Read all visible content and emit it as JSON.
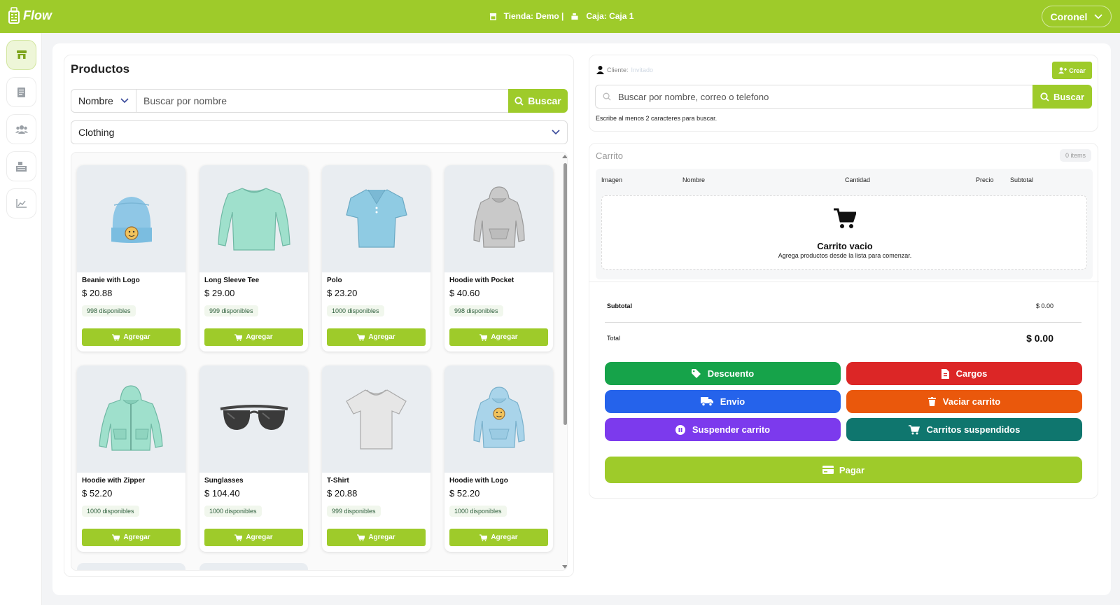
{
  "header": {
    "app_name": "Flow",
    "store_label": "Tienda: Demo |",
    "register_label": "Caja: Caja 1",
    "user_name": "Coronel"
  },
  "sidebar": {
    "items": [
      {
        "icon": "store-icon",
        "active": true
      },
      {
        "icon": "receipt-icon",
        "active": false
      },
      {
        "icon": "users-icon",
        "active": false
      },
      {
        "icon": "warehouse-icon",
        "active": false
      },
      {
        "icon": "chart-line-icon",
        "active": false
      }
    ]
  },
  "products": {
    "title": "Productos",
    "filter_field": "Nombre",
    "search_placeholder": "Buscar por nombre",
    "search_button": "Buscar",
    "category": "Clothing",
    "add_label": "Agregar",
    "items": [
      {
        "name": "Beanie with Logo",
        "price": "$ 20.88",
        "stock": "998 disponibles",
        "image": "beanie"
      },
      {
        "name": "Long Sleeve Tee",
        "price": "$ 29.00",
        "stock": "999 disponibles",
        "image": "longsleeve"
      },
      {
        "name": "Polo",
        "price": "$ 23.20",
        "stock": "1000 disponibles",
        "image": "polo"
      },
      {
        "name": "Hoodie with Pocket",
        "price": "$ 40.60",
        "stock": "998 disponibles",
        "image": "hoodie-gray"
      },
      {
        "name": "Hoodie with Zipper",
        "price": "$ 52.20",
        "stock": "1000 disponibles",
        "image": "hoodie-zip"
      },
      {
        "name": "Sunglasses",
        "price": "$ 104.40",
        "stock": "1000 disponibles",
        "image": "sunglasses"
      },
      {
        "name": "T-Shirt",
        "price": "$ 20.88",
        "stock": "999 disponibles",
        "image": "tshirt"
      },
      {
        "name": "Hoodie with Logo",
        "price": "$ 52.20",
        "stock": "1000 disponibles",
        "image": "hoodie-logo"
      }
    ]
  },
  "client": {
    "label": "Cliente:",
    "value": "Invitado",
    "create_button": "Crear",
    "search_placeholder": "Buscar por nombre, correo o telefono",
    "search_button": "Buscar",
    "hint": "Escribe al menos 2 caracteres para buscar."
  },
  "cart": {
    "title": "Carrito",
    "count": "0 items",
    "columns": [
      "Imagen",
      "Nombre",
      "Cantidad",
      "Precio",
      "Subtotal"
    ],
    "empty_title": "Carrito vacio",
    "empty_subtitle": "Agrega productos desde la lista para comenzar.",
    "subtotal_label": "Subtotal",
    "subtotal_value": "$ 0.00",
    "total_label": "Total",
    "total_value": "$ 0.00",
    "actions": {
      "discount": "Descuento",
      "charges": "Cargos",
      "shipping": "Envio",
      "empty_cart": "Vaciar carrito",
      "suspend": "Suspender carrito",
      "suspended_carts": "Carritos suspendidos"
    },
    "pay_button": "Pagar"
  },
  "colors": {
    "brand": "#9ecb2a",
    "discount": "#16a34a",
    "charges": "#dc2626",
    "shipping": "#2563eb",
    "empty_cart": "#ea580c",
    "suspend": "#7c3aed",
    "suspended_carts": "#0f766e"
  }
}
